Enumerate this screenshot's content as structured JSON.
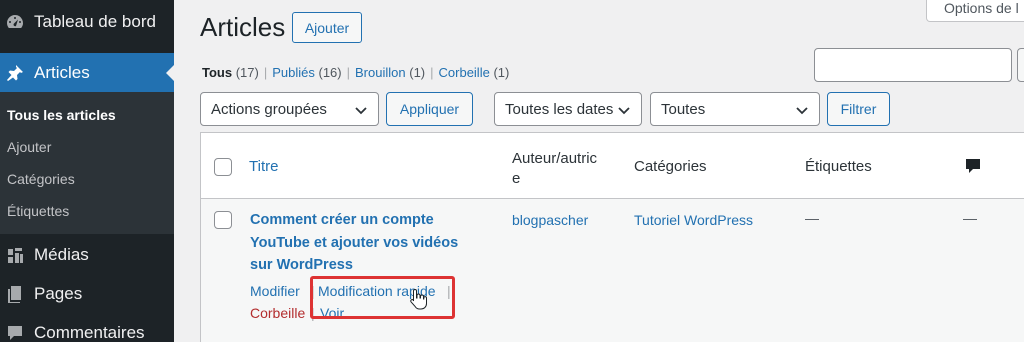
{
  "sidebar": {
    "dashboard": "Tableau de bord",
    "articles": "Articles",
    "submenu": [
      "Tous les articles",
      "Ajouter",
      "Catégories",
      "Étiquettes"
    ],
    "medias": "Médias",
    "pages": "Pages",
    "comments": "Commentaires"
  },
  "header": {
    "title": "Articles",
    "add_new": "Ajouter",
    "screen_options": "Options de l"
  },
  "filters": {
    "all": "Tous",
    "all_count": "(17)",
    "published": "Publiés",
    "published_count": "(16)",
    "draft": "Brouillon",
    "draft_count": "(1)",
    "trash": "Corbeille",
    "trash_count": "(1)"
  },
  "tablenav": {
    "bulk_actions": "Actions groupées",
    "apply": "Appliquer",
    "dates": "Toutes les dates",
    "categories": "Toutes",
    "filter": "Filtrer"
  },
  "table": {
    "headers": {
      "title": "Titre",
      "author_line1": "Auteur/autric",
      "author_line2": "e",
      "categories": "Catégories",
      "tags": "Étiquettes"
    },
    "row": {
      "title": "Comment créer un compte YouTube et ajouter vos vidéos sur WordPress",
      "author": "blogpascher",
      "category": "Tutoriel WordPress",
      "tags": "—",
      "comments": "—",
      "actions": {
        "edit": "Modifier",
        "quick_edit": "Modification rapide",
        "trash": "Corbeille",
        "view": "Voir"
      },
      "pipe": "|"
    }
  },
  "colors": {
    "accent": "#2271b1",
    "sidebar_bg": "#1d2327",
    "highlight": "#dd3333"
  }
}
